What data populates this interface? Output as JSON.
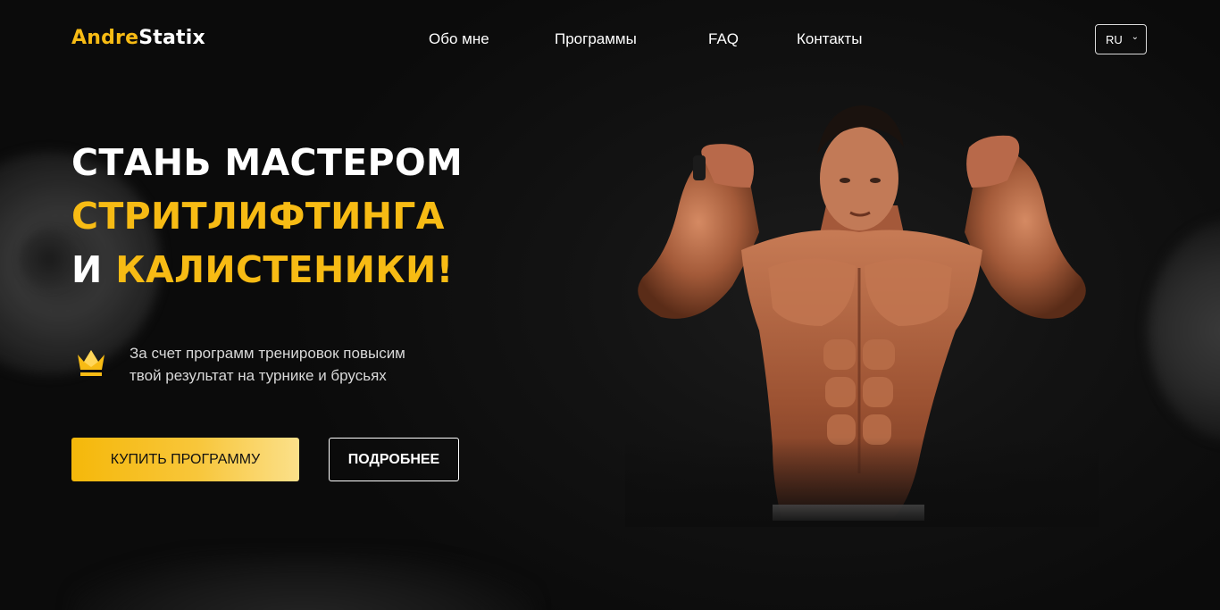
{
  "header": {
    "logo": {
      "part1": "Andre",
      "part2": "Statix"
    },
    "nav": [
      {
        "label": "Обо мне"
      },
      {
        "label": "Программы"
      },
      {
        "label": "FAQ"
      },
      {
        "label": "Контакты"
      }
    ],
    "language": {
      "selected": "RU",
      "icon": "chevron-down-icon"
    }
  },
  "hero": {
    "headline": {
      "line1": "СТАНЬ МАСТЕРОМ",
      "line2": "СТРИТЛИФТИНГА",
      "line3_prefix": "И",
      "line3_highlight": "КАЛИСТЕНИКИ!"
    },
    "feature": {
      "icon": "crown-icon",
      "line1": "За счет программ тренировок повысим",
      "line2": "твой результат на турнике и брусьях"
    },
    "buttons": {
      "buy": "КУПИТЬ ПРОГРАММУ",
      "more": "ПОДРОБНЕЕ"
    }
  },
  "colors": {
    "accent": "#f7bb14",
    "background": "#0d0d0d",
    "text": "#ffffff"
  }
}
